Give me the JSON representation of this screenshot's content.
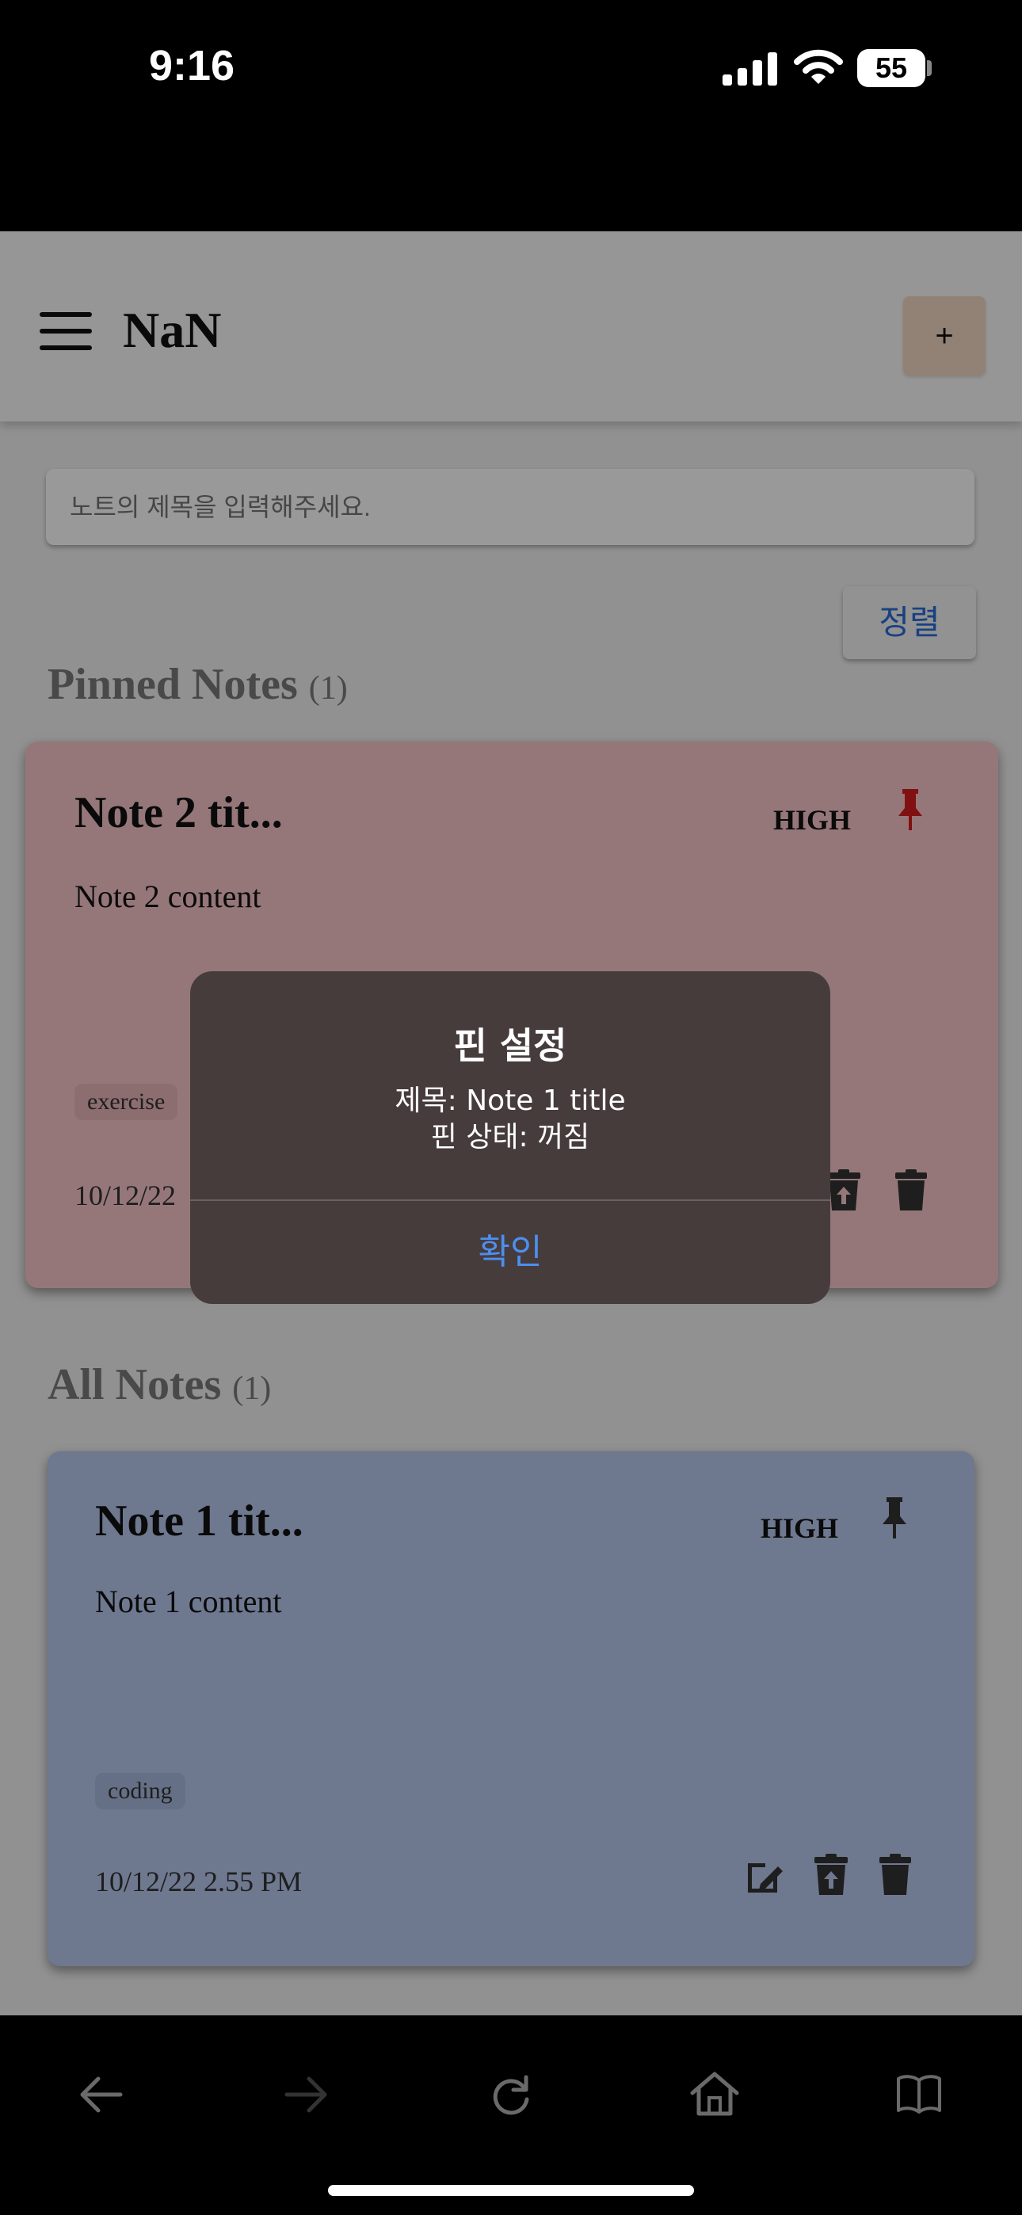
{
  "status_bar": {
    "time": "9:16",
    "battery": "55"
  },
  "header": {
    "menu_icon": "hamburger-icon",
    "brand": "NaN",
    "add_label": "+"
  },
  "search": {
    "placeholder": "노트의 제목을 입력해주세요."
  },
  "sort_button": {
    "label": "정렬"
  },
  "pinned_section": {
    "title": "Pinned Notes",
    "count": "(1)"
  },
  "all_section": {
    "title": "All Notes",
    "count": "(1)"
  },
  "pinned_note": {
    "title": "Note 2 tit...",
    "priority": "HIGH",
    "content": "Note 2 content",
    "tag": "exercise",
    "date": "10/12/22",
    "color": "#f8c6cb",
    "pin_color": "#d81c1c"
  },
  "note": {
    "title": "Note 1 tit...",
    "priority": "HIGH",
    "content": "Note 1 content",
    "tag": "coding",
    "date": "10/12/22 2.55 PM",
    "color": "#b7c9ee"
  },
  "dialog": {
    "title": "핀 설정",
    "line1": "제목: Note 1 title",
    "line2": "핀 상태: 꺼짐",
    "confirm": "확인"
  },
  "toolbar": {
    "icons": [
      "back-icon",
      "forward-icon",
      "reload-icon",
      "home-icon",
      "bookmarks-icon"
    ]
  }
}
